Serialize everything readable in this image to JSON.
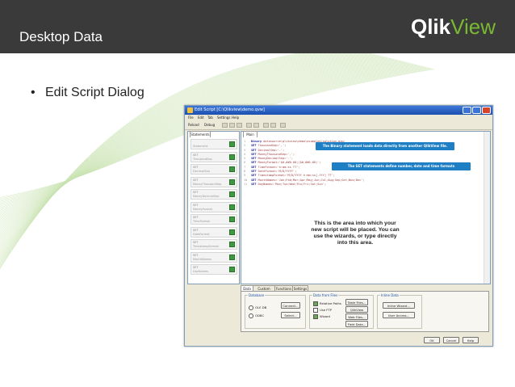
{
  "slide": {
    "title": "Desktop Data",
    "logo_main": "Qlik",
    "logo_accent": "View",
    "bullet": "Edit Script Dialog",
    "colors": {
      "header": "#3a3a3a",
      "logo_accent": "#7ab833",
      "callout": "#1f7fc4"
    }
  },
  "dialog": {
    "title": "Edit Script [C:\\Qlikview\\demo.qvw]",
    "menu": [
      "File",
      "Edit",
      "Tab",
      "Settings",
      "Help"
    ],
    "toolbar": {
      "reload": "Reload",
      "debug": "Debug"
    },
    "left_tab": "Statements",
    "functions": [
      {
        "kw": "",
        "name": "Statement"
      },
      {
        "kw": "SET",
        "name": "ThousandSep"
      },
      {
        "kw": "SET",
        "name": "DecimalSep"
      },
      {
        "kw": "SET",
        "name": "MoneyThousandSep"
      },
      {
        "kw": "SET",
        "name": "MoneyDecimalSep"
      },
      {
        "kw": "SET",
        "name": "MoneyFormat"
      },
      {
        "kw": "SET",
        "name": "TimeFormat"
      },
      {
        "kw": "SET",
        "name": "DateFormat"
      },
      {
        "kw": "SET",
        "name": "TimestampFormat"
      },
      {
        "kw": "SET",
        "name": "MonthNames"
      },
      {
        "kw": "SET",
        "name": "DayNames"
      }
    ],
    "editor_tab": "Main",
    "code": [
      {
        "kw": "Binary",
        "rest": " datasource\\qlikview\\demo\\examples\\solution.qvw;"
      },
      {
        "kw": "SET",
        "rest": " ThousandSep=',';"
      },
      {
        "kw": "SET",
        "rest": " DecimalSep='.';"
      },
      {
        "kw": "SET",
        "rest": " MoneyThousandSep=',';"
      },
      {
        "kw": "SET",
        "rest": " MoneyDecimalSep='.';"
      },
      {
        "kw": "SET",
        "rest": " MoneyFormat='$#,##0.00;($#,##0.00)';"
      },
      {
        "kw": "SET",
        "rest": " TimeFormat='h:mm:ss TT';"
      },
      {
        "kw": "SET",
        "rest": " DateFormat='M/D/YYYY';"
      },
      {
        "kw": "SET",
        "rest": " TimestampFormat='M/D/YYYY h:mm:ss[.fff] TT';"
      },
      {
        "kw": "SET",
        "rest": " MonthNames='Jan;Feb;Mar;Apr;May;Jun;Jul;Aug;Sep;Oct;Nov;Dec';"
      },
      {
        "kw": "SET",
        "rest": " DayNames='Mon;Tue;Wed;Thu;Fri;Sat;Sun';"
      }
    ],
    "callout_binary": "The Binary statement loads data directly from another QlikView file.",
    "callout_set": "The SET statements define number, date and time formats",
    "note": "This is the area into which your new script will be placed. You can use the wizards, or type directly into this area.",
    "bottom_tabs": [
      "Data",
      "Custom Data",
      "Functions",
      "Settings"
    ],
    "database_label": "Database",
    "radio_oledb": "OLE DB",
    "radio_odbc": "ODBC",
    "connect": "Connect...",
    "select": "Select...",
    "datafrom_label": "Data from Files",
    "chk_relative": "Relative Paths",
    "chk_ftp": "Use FTP",
    "chk_wizard": "Wizard",
    "table_files": "Table Files...",
    "qlikview_file": "QlikView File...",
    "web_files": "Web Files...",
    "field_data": "Field Data...",
    "inline_label": "Inline Data",
    "inline_wizard": "Inline Wizard...",
    "user_access": "User Access...",
    "ok": "OK",
    "cancel": "Cancel",
    "help": "Help"
  }
}
